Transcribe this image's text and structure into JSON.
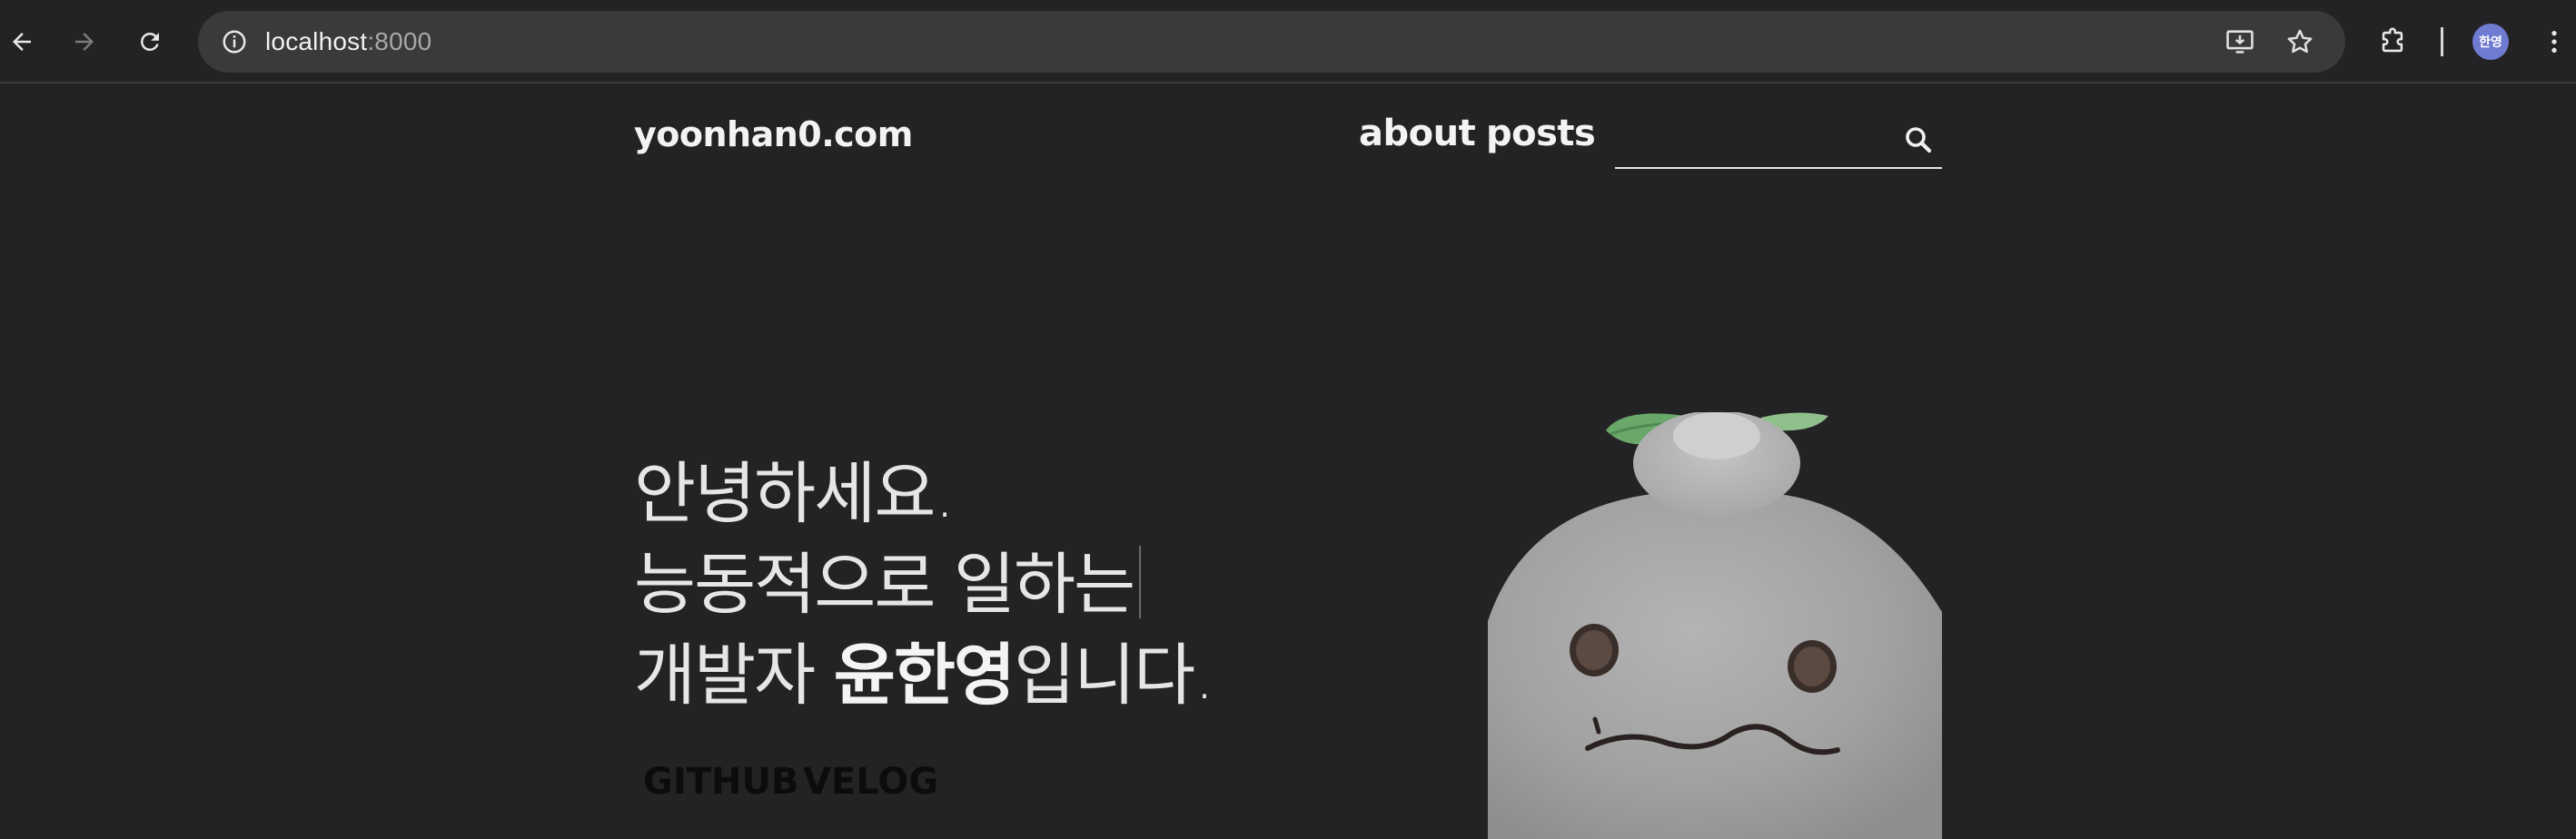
{
  "browser": {
    "url_host": "localhost",
    "url_port": ":8000",
    "profile_initials": "한영",
    "icons": [
      "back-icon",
      "forward-icon",
      "reload-icon",
      "site-info-icon",
      "install-app-icon",
      "bookmark-star-icon",
      "extensions-icon",
      "more-menu-icon"
    ]
  },
  "site": {
    "brand": "yoonhan0.com",
    "nav": {
      "about": "about",
      "posts": "posts"
    },
    "search": {
      "value": "",
      "placeholder": ""
    }
  },
  "hero": {
    "line1": "안녕하세요.",
    "line2": "능동적으로 일하는",
    "line3_prefix": "개발자 ",
    "line3_name": "윤한영",
    "line3_suffix": "입니다."
  },
  "links": {
    "github": "GITHUB",
    "velog": "VELOG"
  },
  "colors": {
    "background": "#232325",
    "omnibox": "#3a3a3c",
    "text": "#f3f3f3",
    "profile": "#6f7bd1"
  }
}
